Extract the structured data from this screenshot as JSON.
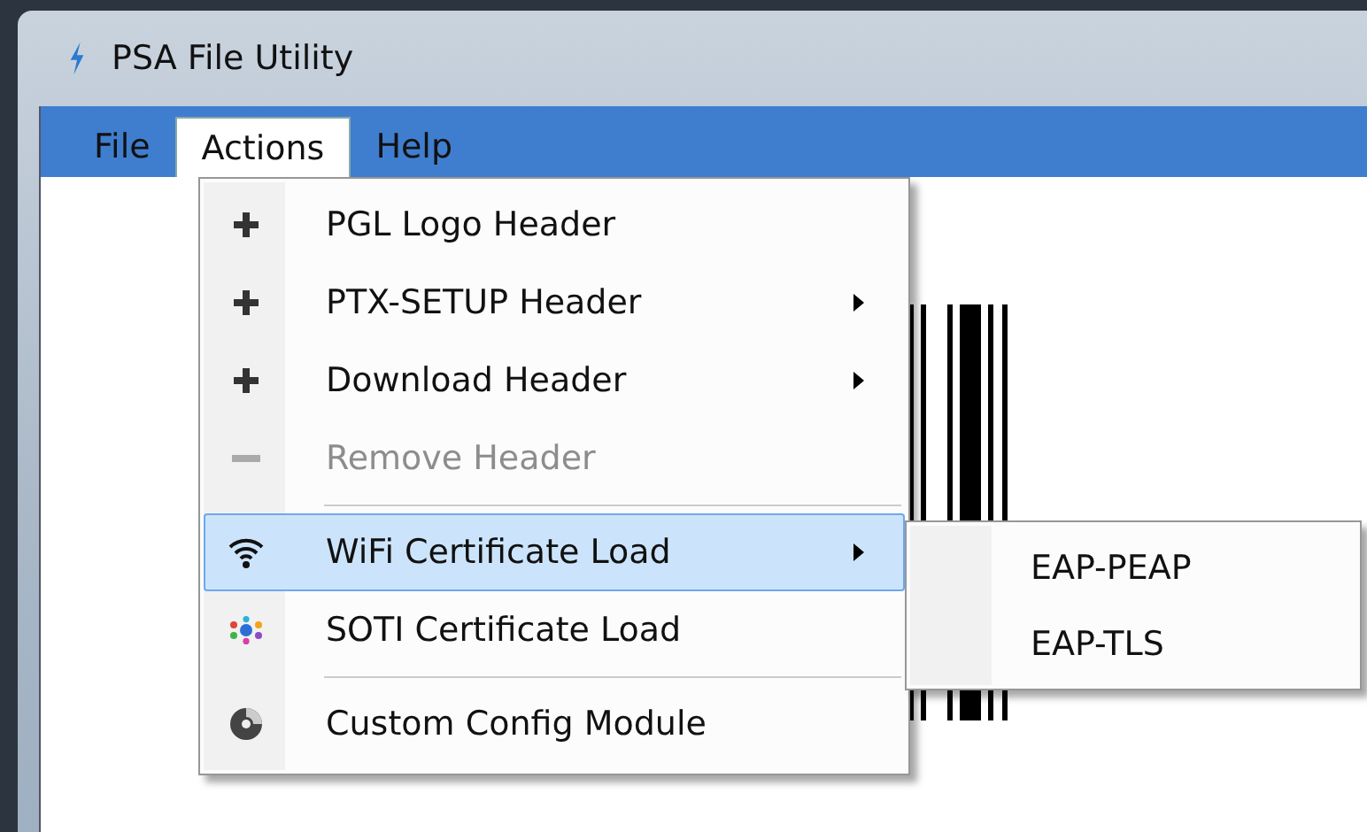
{
  "window": {
    "title": "PSA File Utility"
  },
  "menu_bar": [
    {
      "label": "File",
      "selected": false
    },
    {
      "label": "Actions",
      "selected": true
    },
    {
      "label": "Help",
      "selected": false
    }
  ],
  "actions_menu": [
    {
      "kind": "add",
      "label": "PGL Logo Header",
      "submenu": false,
      "disabled": false,
      "selected": false
    },
    {
      "kind": "add",
      "label": "PTX-SETUP Header",
      "submenu": true,
      "disabled": false,
      "selected": false
    },
    {
      "kind": "add",
      "label": "Download Header",
      "submenu": true,
      "disabled": false,
      "selected": false
    },
    {
      "kind": "remove",
      "label": "Remove Header",
      "submenu": false,
      "disabled": true,
      "selected": false
    },
    {
      "kind": "separator"
    },
    {
      "kind": "wifi",
      "label": "WiFi Certificate Load",
      "submenu": true,
      "disabled": false,
      "selected": true
    },
    {
      "kind": "soti",
      "label": "SOTI Certificate Load",
      "submenu": false,
      "disabled": false,
      "selected": false
    },
    {
      "kind": "separator"
    },
    {
      "kind": "config",
      "label": "Custom Config Module",
      "submenu": false,
      "disabled": false,
      "selected": false
    }
  ],
  "wifi_submenu": [
    {
      "label": "EAP-PEAP",
      "selected": false
    },
    {
      "label": "EAP-TLS",
      "selected": false
    }
  ]
}
